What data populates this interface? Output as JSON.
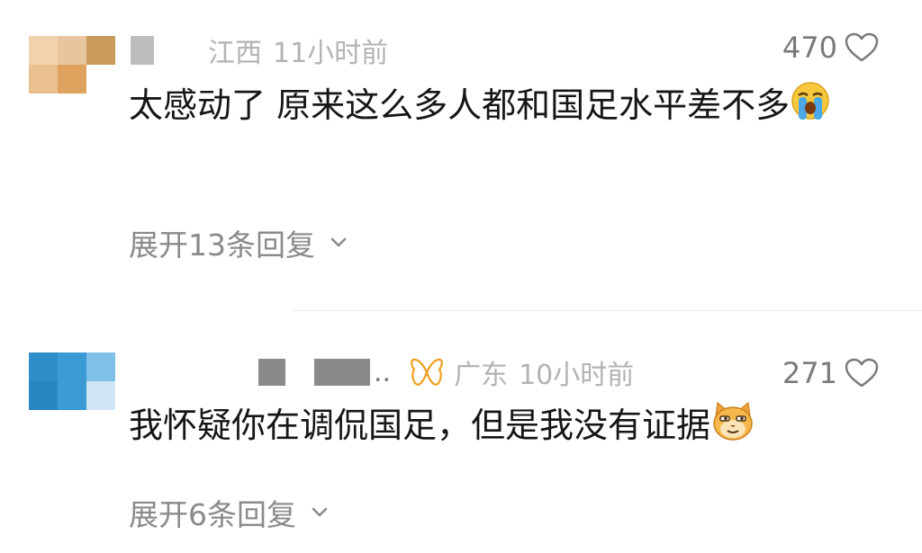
{
  "comments": [
    {
      "location": "江西",
      "time": "11小时前",
      "likes": "470",
      "text": "太感动了 原来这么多人都和国足水平差不多",
      "emoji": "loudly-crying-face",
      "expand_label": "展开13条回复",
      "avatar_colors": [
        "#f1d3ad",
        "#e8c59e",
        "#c99a59",
        "#eac091",
        "#dfa35f",
        "#ffffff"
      ]
    },
    {
      "location": "广东",
      "time": "10小时前",
      "likes": "271",
      "text": "我怀疑你在调侃国足，但是我没有证据",
      "emoji": "smirking-cat-face",
      "badge_icon": "butterfly-icon",
      "expand_label": "展开6条回复",
      "avatar_colors": [
        "#2f8ec9",
        "#3b9ad3",
        "#7fc0e8",
        "#2a86c2",
        "#3a9bd7",
        "#cfe6f5"
      ]
    }
  ]
}
